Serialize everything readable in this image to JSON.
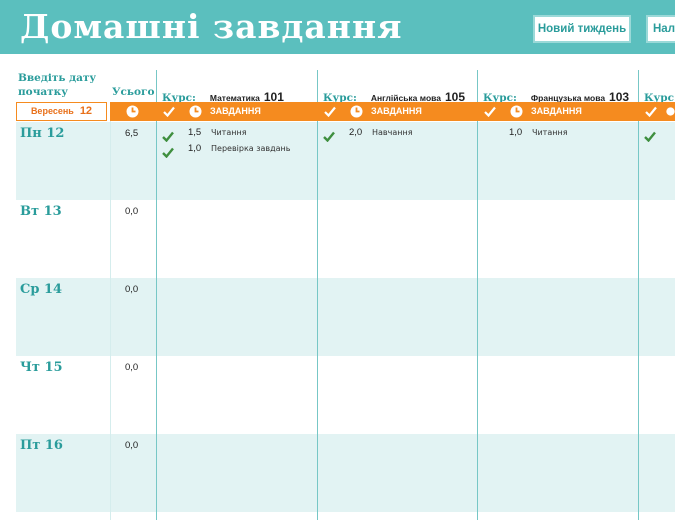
{
  "header": {
    "title": "Домашні завдання",
    "new_week_label": "Новий тиждень",
    "settings_label": "Нал"
  },
  "sidebar": {
    "start_label_line1": "Введіть дату",
    "start_label_line2": "початку",
    "total_label": "Усього",
    "date_month": "Вересень",
    "date_day": "12"
  },
  "courses": [
    {
      "kurs_label": "Курс:",
      "name": "Математика",
      "number": "101",
      "tasks_label": "ЗАВДАННЯ"
    },
    {
      "kurs_label": "Курс:",
      "name": "Англійська мова",
      "number": "105",
      "tasks_label": "ЗАВДАННЯ"
    },
    {
      "kurs_label": "Курс:",
      "name": "Французька мова",
      "number": "103",
      "tasks_label": "ЗАВДАННЯ"
    },
    {
      "kurs_label": "Курс:"
    }
  ],
  "days": [
    {
      "label": "Пн 12",
      "total": "6,5"
    },
    {
      "label": "Вт 13",
      "total": "0,0"
    },
    {
      "label": "Ср 14",
      "total": "0,0"
    },
    {
      "label": "Чт 15",
      "total": "0,0"
    },
    {
      "label": "Пт 16",
      "total": "0,0"
    }
  ],
  "tasks_monday": {
    "math": [
      {
        "hours": "1,5",
        "text": "Читання",
        "done": true
      },
      {
        "hours": "1,0",
        "text": "Перевірка завдань",
        "done": true
      }
    ],
    "english": [
      {
        "hours": "2,0",
        "text": "Навчання",
        "done": true
      }
    ],
    "french": [
      {
        "hours": "1,0",
        "text": "Читання",
        "done": false
      }
    ]
  },
  "colors": {
    "banner": "#5bbfbe",
    "accent_orange": "#f58b1f",
    "row_shade": "#e2f3f3",
    "text_cyan": "#2a9c9b",
    "check_green": "#3f8f3f"
  },
  "icons": {
    "check": "check-icon",
    "clock": "clock-icon"
  }
}
